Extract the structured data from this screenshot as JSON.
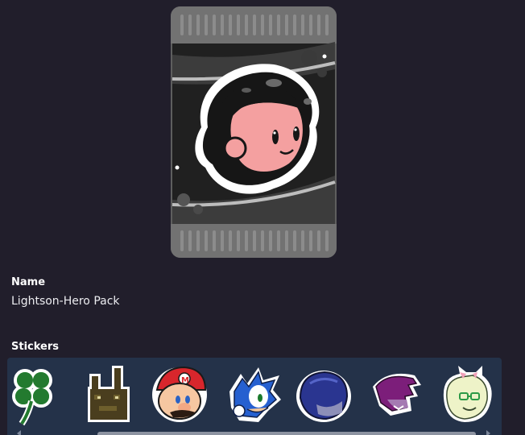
{
  "pack": {
    "image_icon": "sticker-pack-art",
    "name_label": "Name",
    "name_value": "Lightson-Hero Pack"
  },
  "stickers": {
    "label": "Stickers",
    "items": [
      {
        "icon": "clover-sticker-icon"
      },
      {
        "icon": "pixel-bunny-sticker-icon"
      },
      {
        "icon": "mario-sticker-icon"
      },
      {
        "icon": "sonic-sticker-icon"
      },
      {
        "icon": "kris-sticker-icon"
      },
      {
        "icon": "susie-sticker-icon"
      },
      {
        "icon": "ralsei-sticker-icon"
      }
    ]
  },
  "colors": {
    "background": "#211e2b",
    "strip_background": "#243249"
  }
}
